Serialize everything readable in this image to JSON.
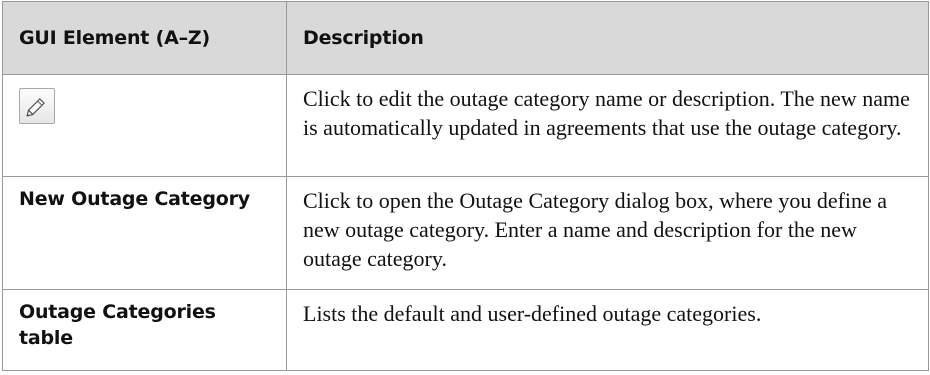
{
  "table": {
    "headers": {
      "element": "GUI Element (A–Z)",
      "description": "Description"
    },
    "rows": [
      {
        "element_icon": "pencil-edit-icon",
        "element": "",
        "description": "Click to edit the outage category name or description. The new name is automatically updated in agreements that use the outage category."
      },
      {
        "element": "New Outage Category",
        "description": "Click to open the Outage Category dialog box, where you define a new outage category. Enter a name and description for the new outage category."
      },
      {
        "element": "Outage Categories table",
        "description": "Lists the default and user-defined outage categories."
      }
    ]
  }
}
